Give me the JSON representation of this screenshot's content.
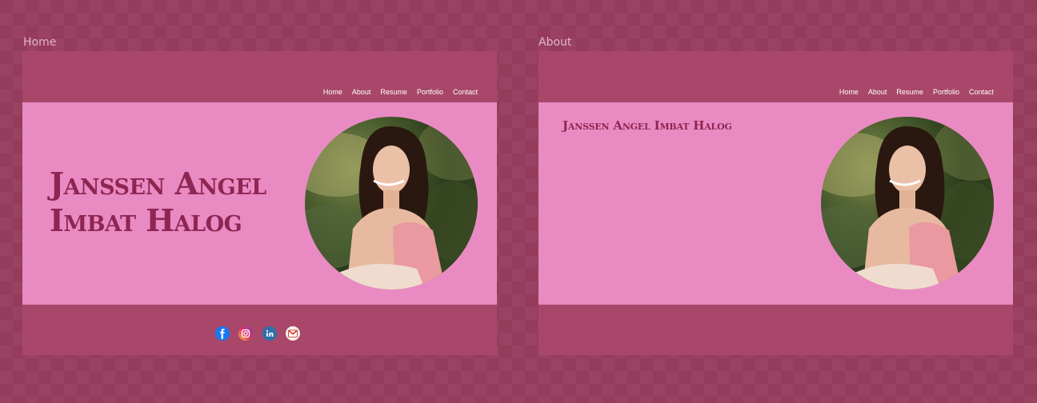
{
  "frames": {
    "home": {
      "label": "Home",
      "name": "Janssen Angel Imbat Halog",
      "nav": [
        "Home",
        "About",
        "Resume",
        "Portfolio",
        "Contact"
      ],
      "social_icons": [
        "facebook-icon",
        "instagram-icon",
        "linkedin-icon",
        "gmail-icon"
      ]
    },
    "about": {
      "label": "About",
      "name": "Janssen Angel Imbat Halog",
      "nav": [
        "Home",
        "About",
        "Resume",
        "Portfolio",
        "Contact"
      ]
    }
  },
  "colors": {
    "canvas": "#953b5c",
    "frame_bar": "#a84769",
    "hero_bg": "#e98bc2",
    "name_text": "#8f2552",
    "nav_text": "#ffffff"
  }
}
